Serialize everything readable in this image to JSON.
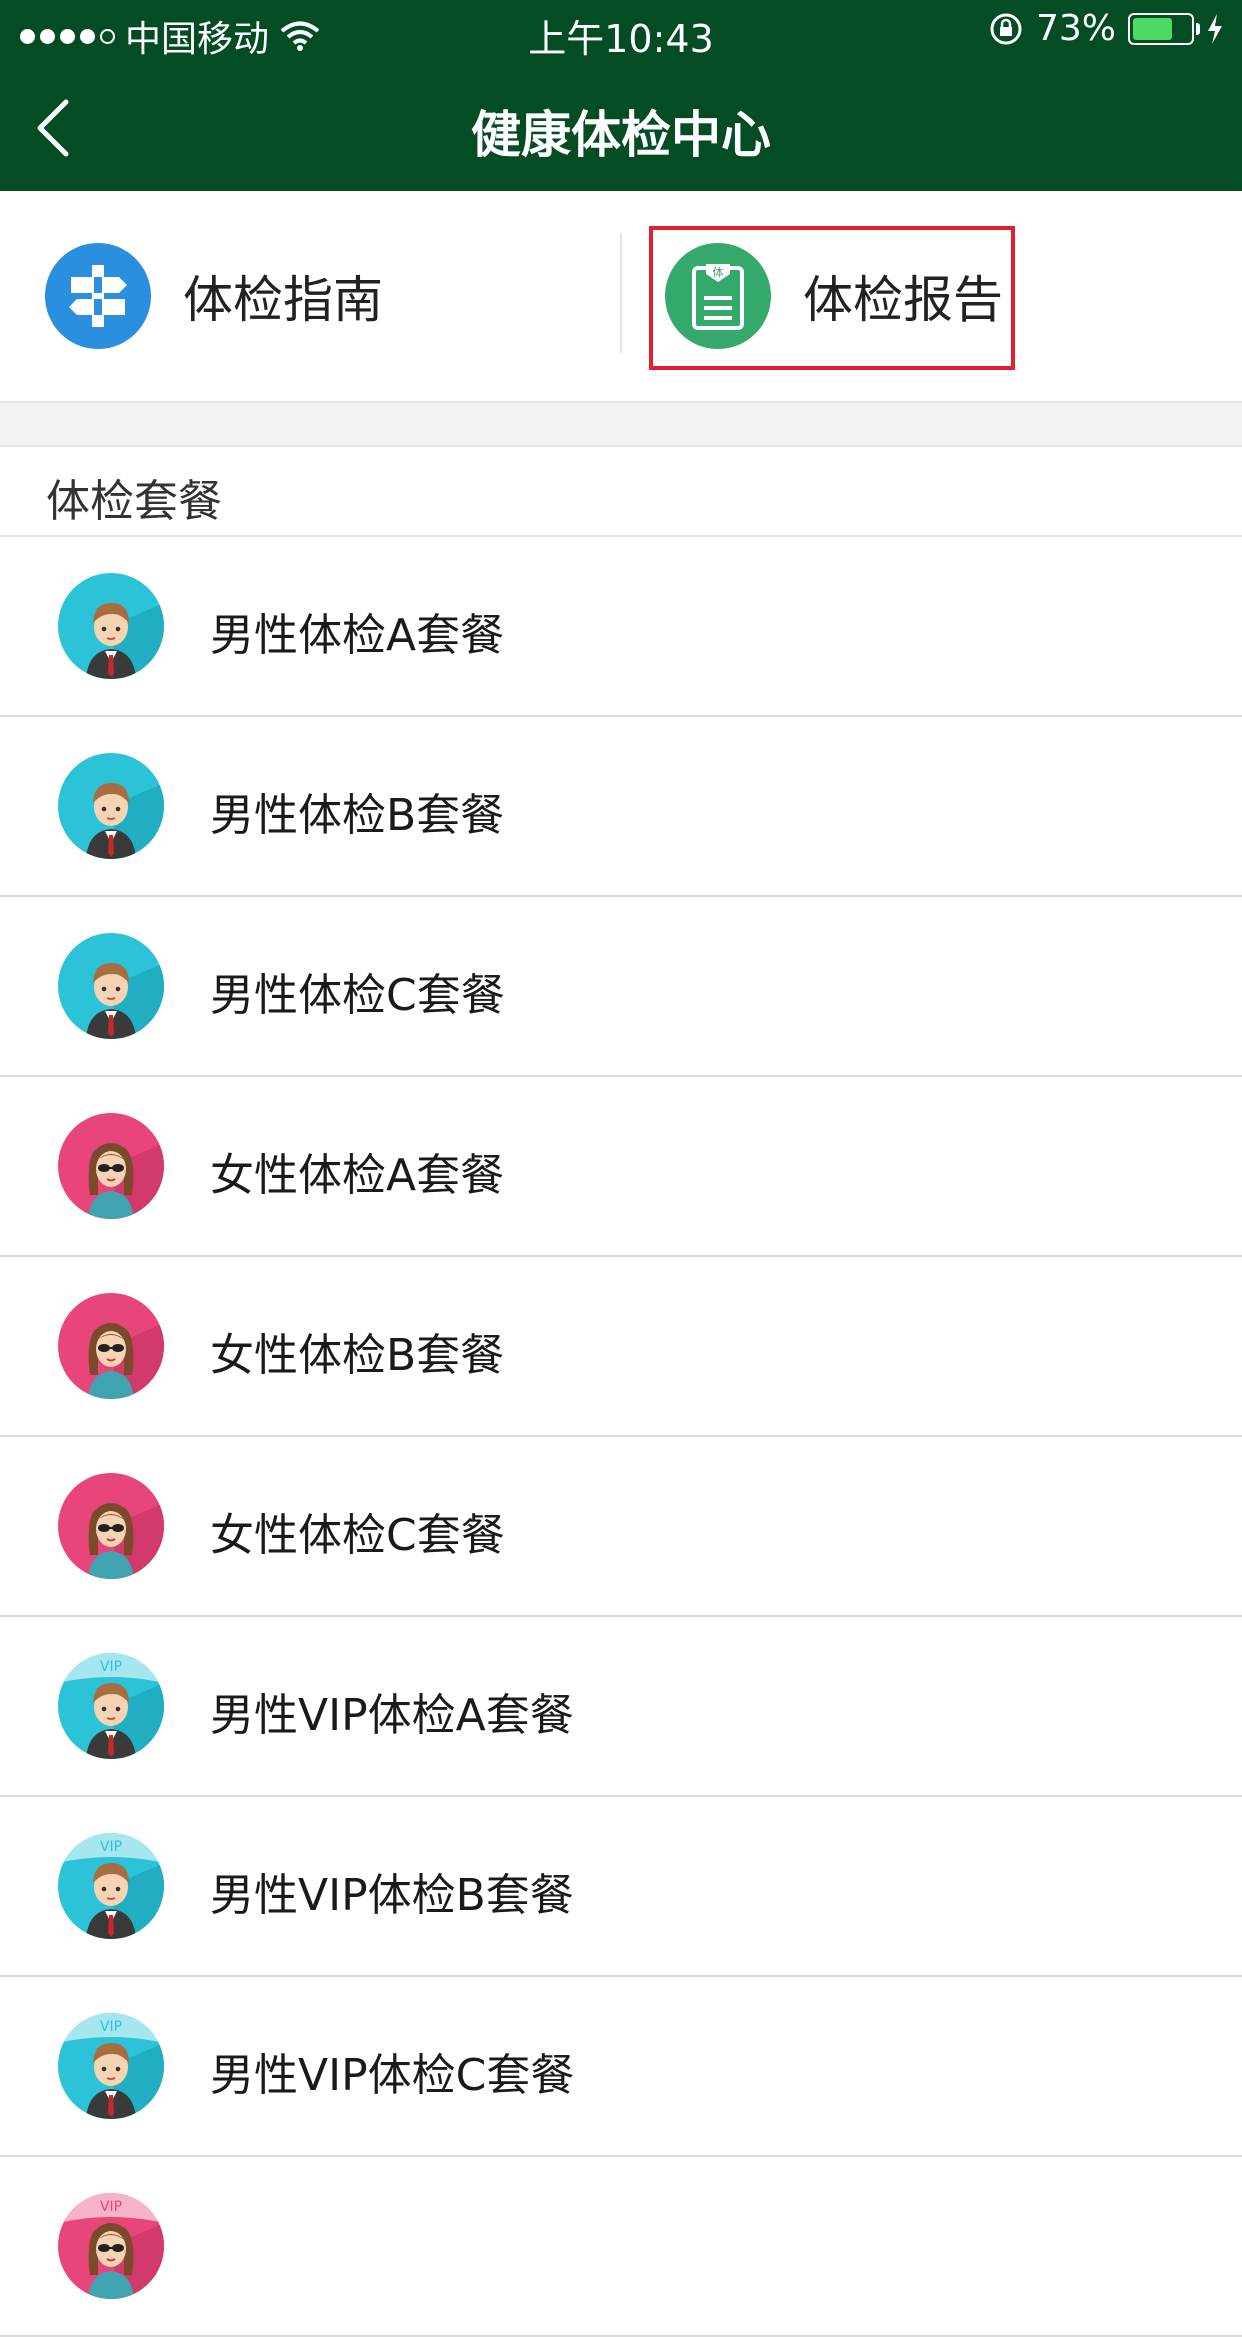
{
  "status_bar": {
    "carrier": "中国移动",
    "time": "上午10:43",
    "battery_percent": "73%",
    "battery_level": 0.73
  },
  "header": {
    "title": "健康体检中心",
    "back_icon": "chevron-left-icon"
  },
  "quick_actions": [
    {
      "label": "体检指南",
      "icon": "signpost-icon",
      "color": "#2b8fe0"
    },
    {
      "label": "体检报告",
      "icon": "clipboard-report-icon",
      "color": "#35a96b"
    }
  ],
  "section": {
    "title": "体检套餐"
  },
  "packages": [
    {
      "name": "男性体检A套餐",
      "avatar": "male"
    },
    {
      "name": "男性体检B套餐",
      "avatar": "male"
    },
    {
      "name": "男性体检C套餐",
      "avatar": "male"
    },
    {
      "name": "女性体检A套餐",
      "avatar": "female"
    },
    {
      "name": "女性体检B套餐",
      "avatar": "female"
    },
    {
      "name": "女性体检C套餐",
      "avatar": "female"
    },
    {
      "name": "男性VIP体检A套餐",
      "avatar": "male-vip",
      "badge": "VIP"
    },
    {
      "name": "男性VIP体检B套餐",
      "avatar": "male-vip",
      "badge": "VIP"
    },
    {
      "name": "男性VIP体检C套餐",
      "avatar": "male-vip",
      "badge": "VIP"
    },
    {
      "name": "",
      "avatar": "female-vip",
      "badge": "VIP"
    }
  ],
  "colors": {
    "header_bg": "#044c24",
    "male_avatar_bg": "#2cc3d8",
    "female_avatar_bg": "#e8457a",
    "highlight_border": "#e0202c"
  }
}
